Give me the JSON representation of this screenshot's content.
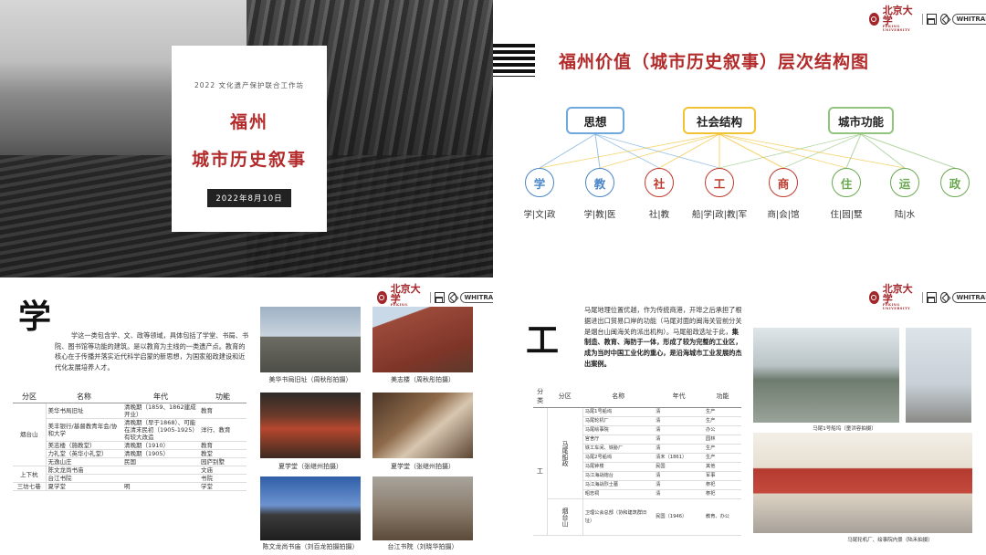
{
  "logos": {
    "pku_text": "北京大学",
    "pku_sub": "PEKING UNIVERSITY",
    "whitrap": "WHITRAP"
  },
  "slide1": {
    "subtitle": "2022 文化遗产保护联合工作坊",
    "title_line1": "福州",
    "title_line2": "城市历史叙事",
    "date": "2022年8月10日"
  },
  "slide2": {
    "title": "福州价值（城市历史叙事）层次结构图",
    "categories": [
      {
        "label": "思想",
        "color": "#6fa8dc"
      },
      {
        "label": "社会结构",
        "color": "#f1c232"
      },
      {
        "label": "城市功能",
        "color": "#93c47d"
      }
    ],
    "nodes": [
      {
        "char": "学",
        "label": "学|文|政",
        "color": "#4a86c8"
      },
      {
        "char": "教",
        "label": "学|教|医",
        "color": "#4a86c8"
      },
      {
        "char": "社",
        "label": "社|教",
        "color": "#c0392b"
      },
      {
        "char": "工",
        "label": "船|学|政|教|军",
        "color": "#c0392b"
      },
      {
        "char": "商",
        "label": "商|会|馆",
        "color": "#c0392b"
      },
      {
        "char": "住",
        "label": "住|园|墅",
        "color": "#6aa84f"
      },
      {
        "char": "运",
        "label": "陆|水",
        "color": "#6aa84f"
      },
      {
        "char": "政",
        "label": "",
        "color": "#6aa84f"
      }
    ]
  },
  "slide3": {
    "big_char": "学",
    "paragraph": "学这一类包含学、文、政等领域，具体包括了学堂、书局、书院、图书馆等功能的建筑。是以教育为主线的一类遗产点。教育的核心在于传播并落实近代科学启蒙的新思想，为国家船政建设和近代化发展培养人才。",
    "table_headers": [
      "分区",
      "名称",
      "年代",
      "功能"
    ],
    "groups": [
      {
        "district": "烟台山",
        "rows": [
          {
            "name": "美华书局旧址",
            "era": "清晚期（1859、1862建成开业）",
            "func": "教育"
          },
          {
            "name": "美丰银行/基督教青年会/协和大学",
            "era": "清晚期（早于1868）、可能在清末民初（1905-1925）有较大改造",
            "func": "洋行、教育"
          },
          {
            "name": "美志楼（施教堂）",
            "era": "清晚期（1910）",
            "func": "教育"
          },
          {
            "name": "力礼堂（英华小礼堂）",
            "era": "清晚期（1905）",
            "func": "教堂"
          },
          {
            "name": "无逸山庄",
            "era": "民国",
            "func": "园庐别墅"
          }
        ]
      },
      {
        "district": "上下杭",
        "rows": [
          {
            "name": "陈文龙尚书庙",
            "era": "",
            "func": "文庙"
          },
          {
            "name": "台江书院",
            "era": "",
            "func": "书院"
          }
        ]
      },
      {
        "district": "三坊七巷",
        "rows": [
          {
            "name": "夏学堂",
            "era": "明",
            "func": "学堂"
          }
        ]
      }
    ],
    "captions": [
      "美华书局旧址（周秋彤拍摄）",
      "美志楼（周秋彤拍摄）",
      "夏学堂（张继州拍摄）",
      "夏学堂（张继州拍摄）",
      "陈文龙尚书庙（刘百龙拍摄拍摄）",
      "台江书院（刘晓华拍摄）"
    ]
  },
  "slide4": {
    "big_char": "工",
    "paragraph_plain": "马尾地理位置优越，作为传统商港，开埠之后承担了根据进出口贸易口岸的功能（马尾对面的闽海关管前分关是烟台山闽海关的派出机构）。马尾船政选址于此，",
    "paragraph_bold": "集制造、教育、海防于一体，形成了较为完整的工业区，成为当时中国工业化的重心，是沿海城市工业发展的杰出案例。",
    "table_headers": [
      "分类",
      "分区",
      "名称",
      "年代",
      "功能"
    ],
    "category": "工",
    "groups": [
      {
        "district": "马尾船政",
        "rows": [
          {
            "name": "马尾1号船坞",
            "era": "清",
            "func": "生产"
          },
          {
            "name": "马尾轮机厂",
            "era": "清",
            "func": "生产"
          },
          {
            "name": "马尾绘事院",
            "era": "清",
            "func": "办公"
          },
          {
            "name": "官舍厅",
            "era": "清",
            "func": "园林"
          },
          {
            "name": "铁工车间、铁胁厂",
            "era": "清",
            "func": "生产"
          },
          {
            "name": "马尾2号船坞",
            "era": "清末（1861）",
            "func": "生产"
          },
          {
            "name": "马尾钟楼",
            "era": "民国",
            "func": "其他"
          },
          {
            "name": "马江海战炮台",
            "era": "清",
            "func": "军事"
          },
          {
            "name": "马江海战烈士墓",
            "era": "清",
            "func": "祭祀"
          },
          {
            "name": "昭忠祠",
            "era": "清",
            "func": "祭祀"
          }
        ]
      },
      {
        "district": "烟台山",
        "rows": [
          {
            "name": "卫理公会总部（协和建筑群旧址）",
            "era": "民国（1946）",
            "func": "教育、办公"
          }
        ]
      }
    ],
    "captions": [
      "马尾1号船坞（童洪容拍摄）",
      "马尾轮机厂、绘事院内景（陆禾拍摄）"
    ]
  }
}
